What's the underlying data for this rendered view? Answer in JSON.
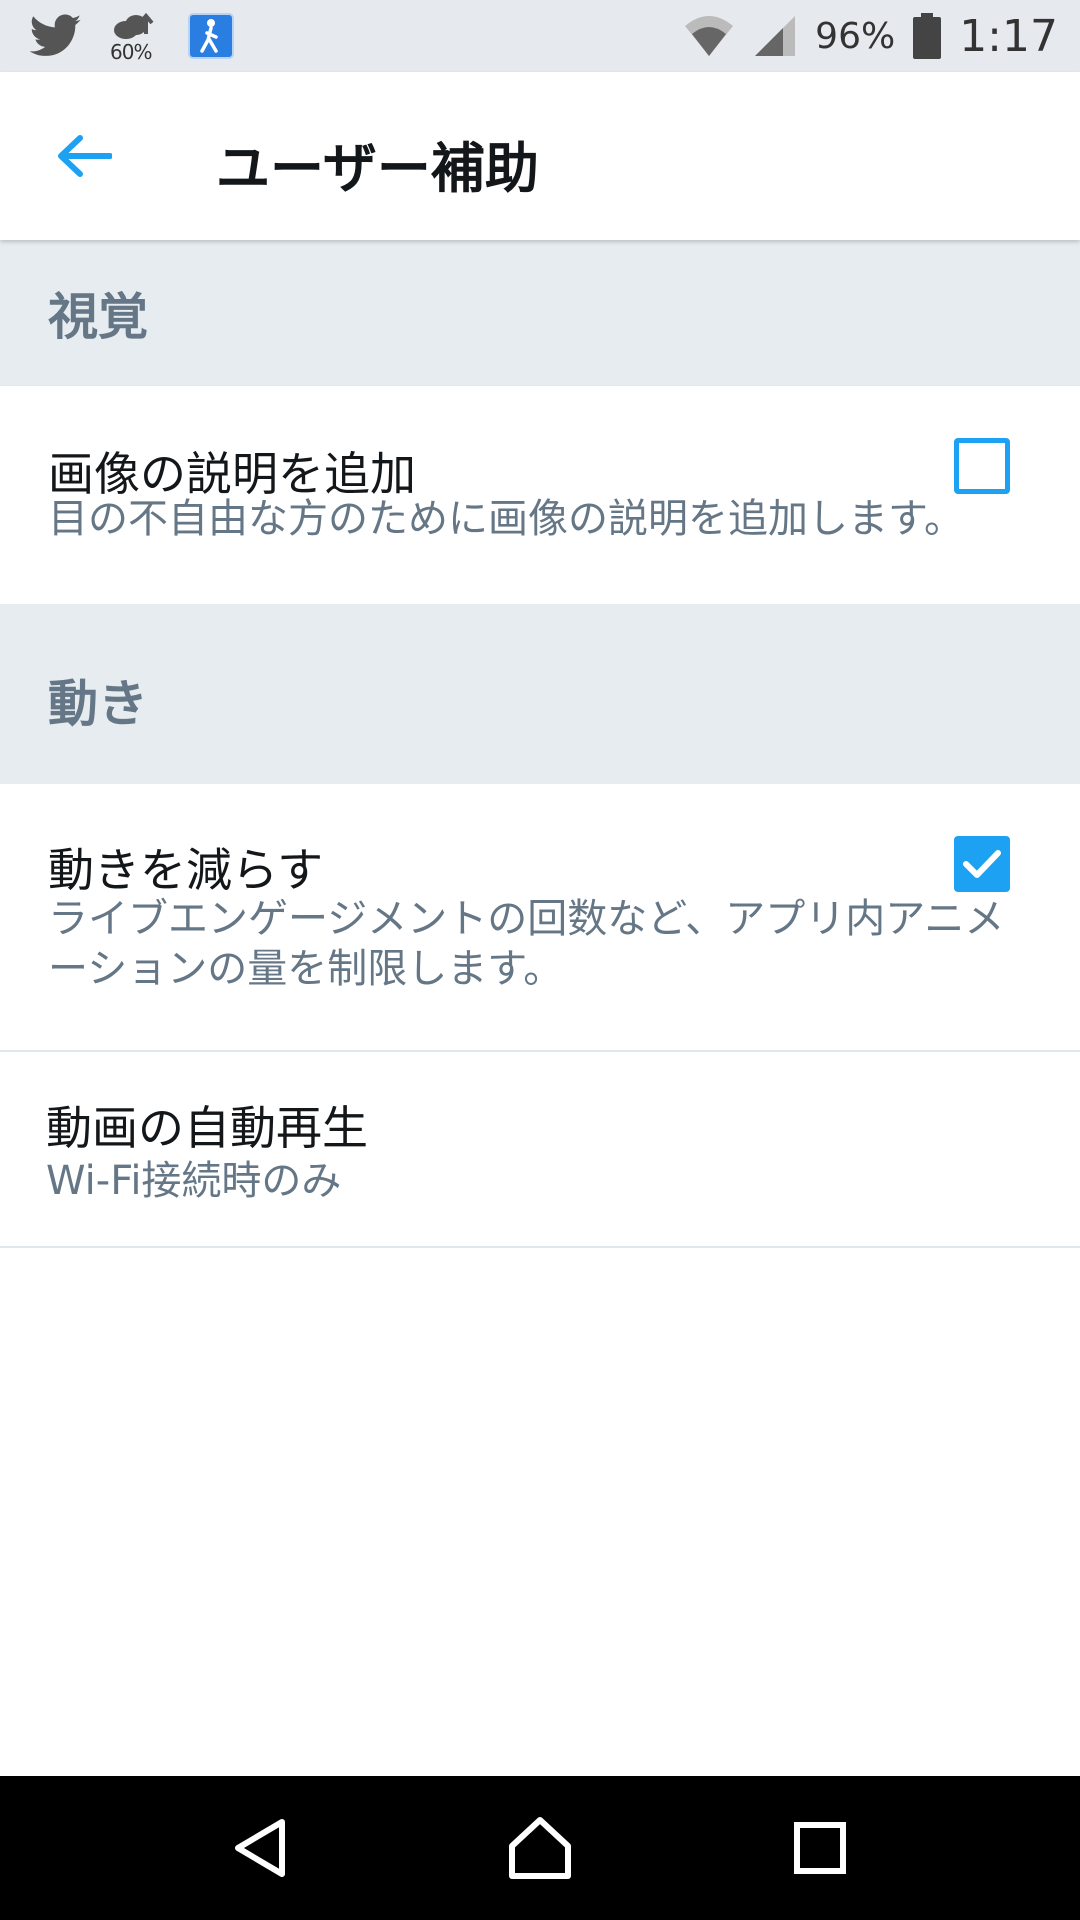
{
  "status_bar": {
    "weather_percent": "60%",
    "battery_percent": "96%",
    "time": "1:17",
    "icons": [
      "twitter-icon",
      "weather-icon",
      "accessibility-app-icon",
      "wifi-icon",
      "signal-icon",
      "battery-icon"
    ]
  },
  "app_bar": {
    "title": "ユーザー補助",
    "back_icon": "back-arrow-icon"
  },
  "sections": [
    {
      "header": "視覚",
      "items": [
        {
          "title": "画像の説明を追加",
          "subtitle": "目の不自由な方のために画像の説明を追加します。",
          "checked": false
        }
      ]
    },
    {
      "header": "動き",
      "items": [
        {
          "title": "動きを減らす",
          "subtitle": "ライブエンゲージメントの回数など、アプリ内アニメーションの量を制限します。",
          "checked": true
        },
        {
          "title": "動画の自動再生",
          "subtitle": "Wi-Fi接続時のみ"
        }
      ]
    }
  ],
  "colors": {
    "accent": "#1da1f2",
    "section_bg": "#e6ecf0",
    "secondary_text": "#657786",
    "primary_text": "#14171a"
  },
  "nav_bar": {
    "icons": [
      "back-nav-icon",
      "home-nav-icon",
      "recents-nav-icon"
    ]
  }
}
